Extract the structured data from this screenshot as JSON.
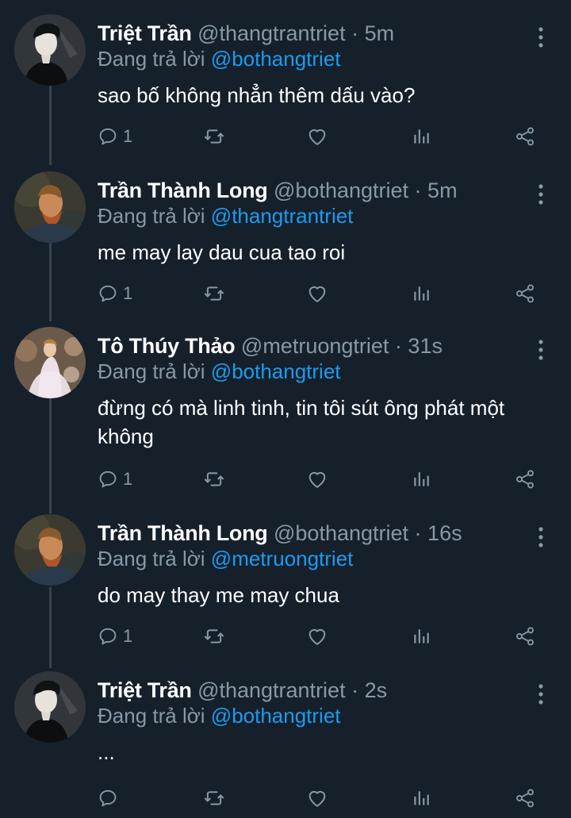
{
  "colors": {
    "background": "#15202b",
    "muted": "#8899a6",
    "link": "#1d9bf0",
    "thread_line": "#38444d"
  },
  "tweets": [
    {
      "name": "Triệt Trần",
      "handle": "@thangtrantriet",
      "dot": "·",
      "time": "5m",
      "reply_prefix": "Đang trả lời",
      "reply_to": "@bothangtriet",
      "text": "sao bố không nhẳn thêm dấu vào?",
      "reply_count": "1",
      "avatar_icon": "avatar-man-dark"
    },
    {
      "name": "Trần Thành Long",
      "handle": "@bothangtriet",
      "dot": "·",
      "time": "5m",
      "reply_prefix": "Đang trả lời",
      "reply_to": "@thangtrantriet",
      "text": "me may lay dau cua tao roi",
      "reply_count": "1",
      "avatar_icon": "avatar-painting-portrait"
    },
    {
      "name": "Tô Thúy Thảo",
      "handle": "@metruongtriet",
      "dot": "·",
      "time": "31s",
      "reply_prefix": "Đang trả lời",
      "reply_to": "@bothangtriet",
      "text": "đừng có mà linh tinh, tin tôi sút ông phát một không",
      "reply_count": "1",
      "avatar_icon": "avatar-woman-dress"
    },
    {
      "name": "Trần Thành Long",
      "handle": "@bothangtriet",
      "dot": "·",
      "time": "16s",
      "reply_prefix": "Đang trả lời",
      "reply_to": "@metruongtriet",
      "text": "do may thay me may chua",
      "reply_count": "1",
      "avatar_icon": "avatar-painting-portrait"
    },
    {
      "name": "Triệt Trần",
      "handle": "@thangtrantriet",
      "dot": "·",
      "time": "2s",
      "reply_prefix": "Đang trả lời",
      "reply_to": "@bothangtriet",
      "text": "...",
      "reply_count": "",
      "avatar_icon": "avatar-man-dark"
    }
  ],
  "action_icons": [
    "reply-icon",
    "retweet-icon",
    "like-icon",
    "analytics-icon",
    "share-icon"
  ],
  "more_icon": "more-vertical-icon"
}
